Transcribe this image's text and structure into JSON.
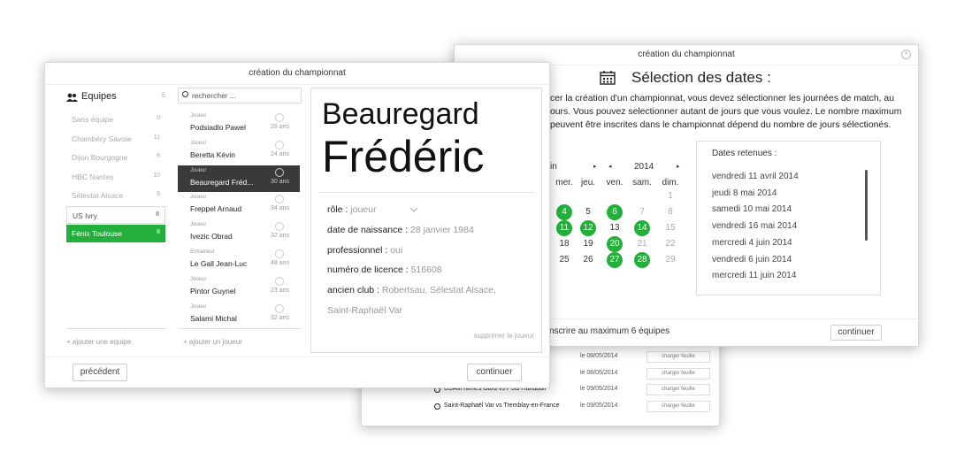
{
  "matches": [
    {
      "title": "",
      "date": "le 08/05/2014",
      "button": "charger feuille"
    },
    {
      "title": "",
      "date": "le 08/05/2014",
      "button": "charger feuille"
    },
    {
      "title": "USAM Nîmes Gard vs PSG Handball",
      "date": "le 09/05/2014",
      "button": "charger feuille"
    },
    {
      "title": "Saint-Raphaël Var vs Tremblay-en-France",
      "date": "le 09/05/2014",
      "button": "charger feuille"
    }
  ],
  "dates_window": {
    "title": "création du championnat",
    "heading": "Sélection des dates :",
    "text_lines": [
      "cer la création d'un championnat, vous devez sélectionner les journées de match, au",
      "ours. Vous pouvez selectionner autant de jours que vous voulez. Le nombre maximum",
      "peuvent être inscrites dans le championnat dépend du nombre de jours sélectionés."
    ],
    "month": "in",
    "year": "2014",
    "day_headers": [
      "mer.",
      "jeu.",
      "ven.",
      "sam.",
      "dim."
    ],
    "rows": [
      [
        "",
        "",
        "",
        "",
        "1"
      ],
      [
        "4",
        "5",
        "6",
        "7",
        "8"
      ],
      [
        "11",
        "12",
        "13",
        "14",
        "15"
      ],
      [
        "18",
        "19",
        "20",
        "21",
        "22"
      ],
      [
        "25",
        "26",
        "27",
        "28",
        "29"
      ]
    ],
    "selected_days": [
      "4",
      "6",
      "11",
      "12",
      "14",
      "20",
      "27",
      "28"
    ],
    "retained_header": "Dates retenues :",
    "retained": [
      "vendredi 11 avril 2014",
      "jeudi 8 mai 2014",
      "samedi 10 mai 2014",
      "vendredi 16 mai 2014",
      "mercredi 4 juin 2014",
      "vendredi 6 juin 2014",
      "mercredi 11 juin 2014"
    ],
    "footer_info": "nscrire au maximum 6 équipes",
    "continue": "continuer"
  },
  "main_window": {
    "title": "création du championnat",
    "teams_header": "Equipes",
    "teams_count": "6",
    "teams": [
      {
        "name": "Sans équipe",
        "count": "0",
        "state": "normal"
      },
      {
        "name": "Chambéry Savoie",
        "count": "11",
        "state": "normal"
      },
      {
        "name": "Dijon Bourgogne",
        "count": "8",
        "state": "normal"
      },
      {
        "name": "HBC Nantes",
        "count": "10",
        "state": "normal"
      },
      {
        "name": "Sélestat Alsace",
        "count": "9",
        "state": "normal"
      },
      {
        "name": "US Ivry",
        "count": "8",
        "state": "bordered"
      },
      {
        "name": "Fénix Toulouse",
        "count": "8",
        "state": "selected"
      }
    ],
    "add_team": "+ ajouter une equipe",
    "search_placeholder": "rechercher ...",
    "players": [
      {
        "role": "Joueur",
        "name": "Podsiadlo Pawel",
        "age": "28 ans"
      },
      {
        "role": "Joueur",
        "name": "Beretta Kévin",
        "age": "24 ans"
      },
      {
        "role": "Joueur",
        "name": "Beauregard Fréd...",
        "age": "30 ans"
      },
      {
        "role": "Joueur",
        "name": "Freppel Arnaud",
        "age": "34 ans"
      },
      {
        "role": "Joueur",
        "name": "Ivezic Obrad",
        "age": "32 ans"
      },
      {
        "role": "Entraineur",
        "name": "Le Gall Jean-Luc",
        "age": "48 ans"
      },
      {
        "role": "Joueur",
        "name": "Pintor Guynel",
        "age": "23 ans"
      },
      {
        "role": "Joueur",
        "name": "Salami Michal",
        "age": "32 ans"
      }
    ],
    "selected_player_index": 2,
    "add_player": "+ ajouter un joueur",
    "detail": {
      "last_name": "Beauregard",
      "first_name": "Frédéric",
      "role_label": "rôle :",
      "role_value": "joueur",
      "birth_label": "date de naissance :",
      "birth_value": "28 janvier 1984",
      "pro_label": "professionnel :",
      "pro_value": "oui",
      "licence_label": "numéro de licence :",
      "licence_value": "516608",
      "club_label": "ancien club :",
      "club_value_1": "Robertsau, Sélestat Alsace,",
      "club_value_2": "Saint-Raphaël Var",
      "delete": "supprimer le joueur"
    },
    "previous": "précédent",
    "continue": "continuer"
  },
  "colors": {
    "accent": "#22b03a",
    "selected_row": "#3a3a3a"
  }
}
